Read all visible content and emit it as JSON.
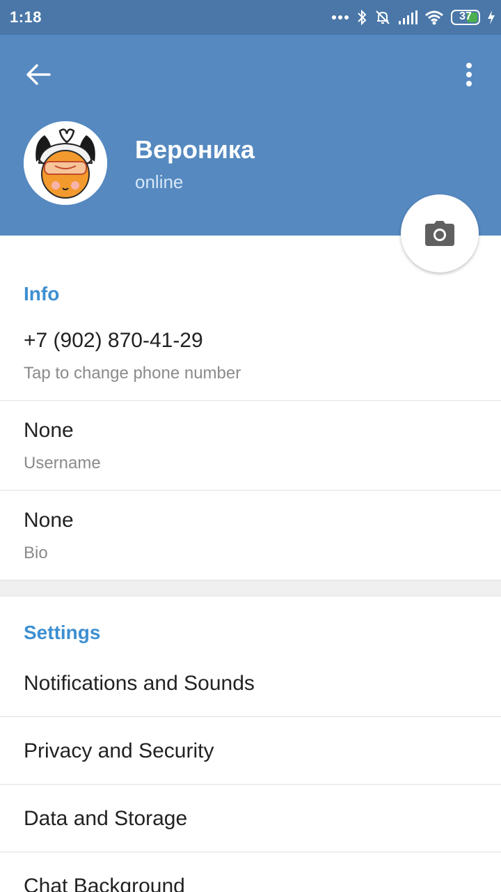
{
  "status_bar": {
    "time": "1:18",
    "battery_level": "37",
    "icons": [
      "more-dots-icon",
      "bluetooth-icon",
      "mute-bell-icon",
      "signal-icon",
      "wifi-icon",
      "battery-icon",
      "charging-icon"
    ]
  },
  "header": {
    "name": "Вероника",
    "status": "online",
    "background_color": "#5589c0"
  },
  "info": {
    "title": "Info",
    "phone": "+7 (902) 870-41-29",
    "phone_hint": "Tap to change phone number",
    "username_value": "None",
    "username_label": "Username",
    "bio_value": "None",
    "bio_label": "Bio"
  },
  "settings": {
    "title": "Settings",
    "items": [
      {
        "label": "Notifications and Sounds"
      },
      {
        "label": "Privacy and Security"
      },
      {
        "label": "Data and Storage"
      },
      {
        "label": "Chat Background"
      }
    ]
  },
  "colors": {
    "accent": "#3d8fd1",
    "status_bar": "#4a77a8"
  }
}
